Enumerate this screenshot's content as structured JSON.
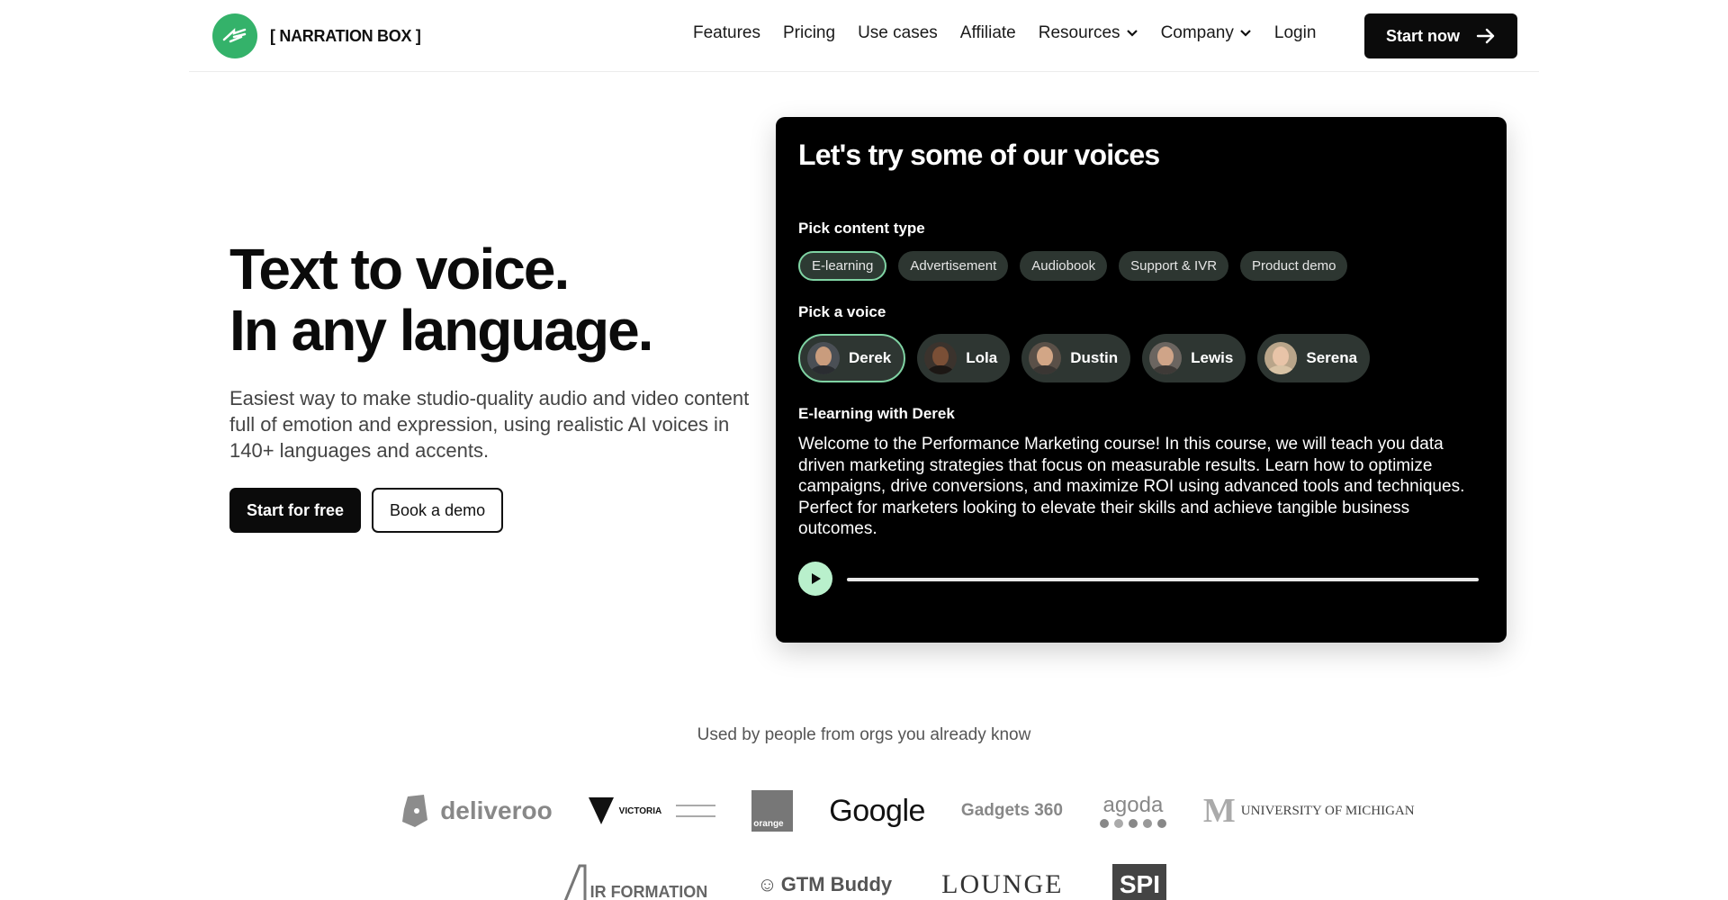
{
  "brand": {
    "name": "[ NARRATION BOX ]",
    "accent": "#34b26a"
  },
  "nav": {
    "items": [
      {
        "label": "Features"
      },
      {
        "label": "Pricing"
      },
      {
        "label": "Use cases"
      },
      {
        "label": "Affiliate"
      },
      {
        "label": "Resources",
        "dropdown": true
      },
      {
        "label": "Company",
        "dropdown": true
      },
      {
        "label": "Login"
      }
    ],
    "cta_label": "Start now"
  },
  "hero": {
    "title_line1": "Text to voice.",
    "title_line2": "In any language.",
    "subtitle": "Easiest way to make studio-quality audio and video content full of emotion and expression, using realistic AI voices in 140+ languages and accents.",
    "primary_button": "Start for free",
    "secondary_button": "Book a demo"
  },
  "demo": {
    "title": "Let's try some of our voices",
    "content_type_label": "Pick content type",
    "content_types": [
      "E-learning",
      "Advertisement",
      "Audiobook",
      "Support & IVR",
      "Product demo"
    ],
    "selected_content_type": "E-learning",
    "voice_label": "Pick a voice",
    "voices": [
      "Derek",
      "Lola",
      "Dustin",
      "Lewis",
      "Serena"
    ],
    "selected_voice": "Derek",
    "sample_title": "E-learning with Derek",
    "sample_text": "Welcome to the Performance Marketing course! In this course, we will teach you data driven marketing strategies that focus on measurable results. Learn how to optimize campaigns, drive conversions, and maximize ROI using advanced tools and techniques. Perfect for marketers looking to elevate their skills and achieve tangible business outcomes.",
    "playback_progress": 0
  },
  "orgs": {
    "heading": "Used by people from orgs you already know",
    "row1": [
      "deliveroo",
      "VICTORIA",
      "orange",
      "Google",
      "Gadgets 360",
      "agoda",
      "UNIVERSITY OF MICHIGAN"
    ],
    "row2": [
      "IR FORMATION",
      "GTM Buddy",
      "LOUNGE",
      "SPI"
    ]
  }
}
